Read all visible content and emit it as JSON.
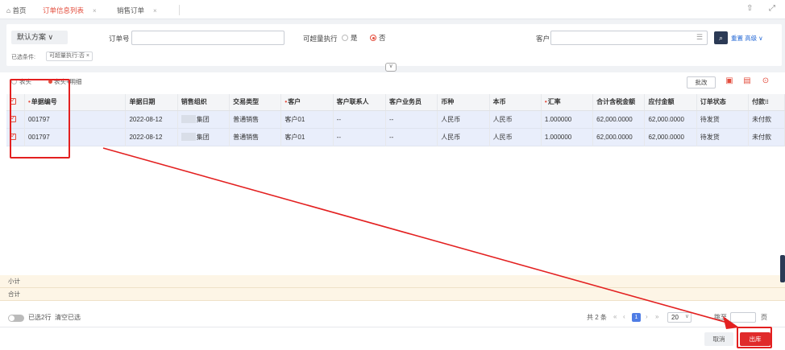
{
  "tabs": [
    {
      "label": "首页"
    },
    {
      "label": "订单信息列表",
      "close": "×"
    },
    {
      "label": "销售订单",
      "close": "×"
    }
  ],
  "filter": {
    "scheme": "默认方案",
    "order_no_label": "订单号",
    "overexec_label": "可超量执行",
    "opt_yes": "是",
    "opt_no": "否",
    "customer_label": "客户",
    "advanced_label": "重置 高级",
    "selected_label": "已选条件:",
    "selected_tag": "可超量执行:否 ×"
  },
  "views": {
    "header_only": "表头",
    "header_detail": "表头+明细"
  },
  "batch_label": "批改",
  "columns": [
    "单据编号",
    "单据日期",
    "销售组织",
    "交易类型",
    "客户",
    "客户联系人",
    "客户业务员",
    "币种",
    "本币",
    "汇率",
    "合计含税金额",
    "应付金额",
    "订单状态",
    "付款"
  ],
  "required_columns": [
    "单据编号",
    "客户",
    "汇率"
  ],
  "rows": [
    [
      "001797",
      "2022-08-12",
      "集团",
      "普通销售",
      "客户01",
      "--",
      "--",
      "人民币",
      "人民币",
      "1.000000",
      "62,000.0000",
      "62,000.0000",
      "待发货",
      "未付款"
    ],
    [
      "001797",
      "2022-08-12",
      "集团",
      "普通销售",
      "客户01",
      "--",
      "--",
      "人民币",
      "人民币",
      "1.000000",
      "62,000.0000",
      "62,000.0000",
      "待发货",
      "未付款"
    ]
  ],
  "subtotal_label": "小计",
  "total_label": "合计",
  "footer": {
    "selected_rows": "已选2行",
    "clear_selection": "清空已选",
    "total_count": "共 2 条",
    "current_page": "1",
    "page_size": "20",
    "goto_label": "跳至",
    "page_unit": "页"
  },
  "buttons": {
    "cancel": "取消",
    "stock_out": "出库"
  },
  "colors": {
    "accent": "#e34d3d",
    "annotation": "#e32020",
    "primary_button": "#e02b2b"
  }
}
